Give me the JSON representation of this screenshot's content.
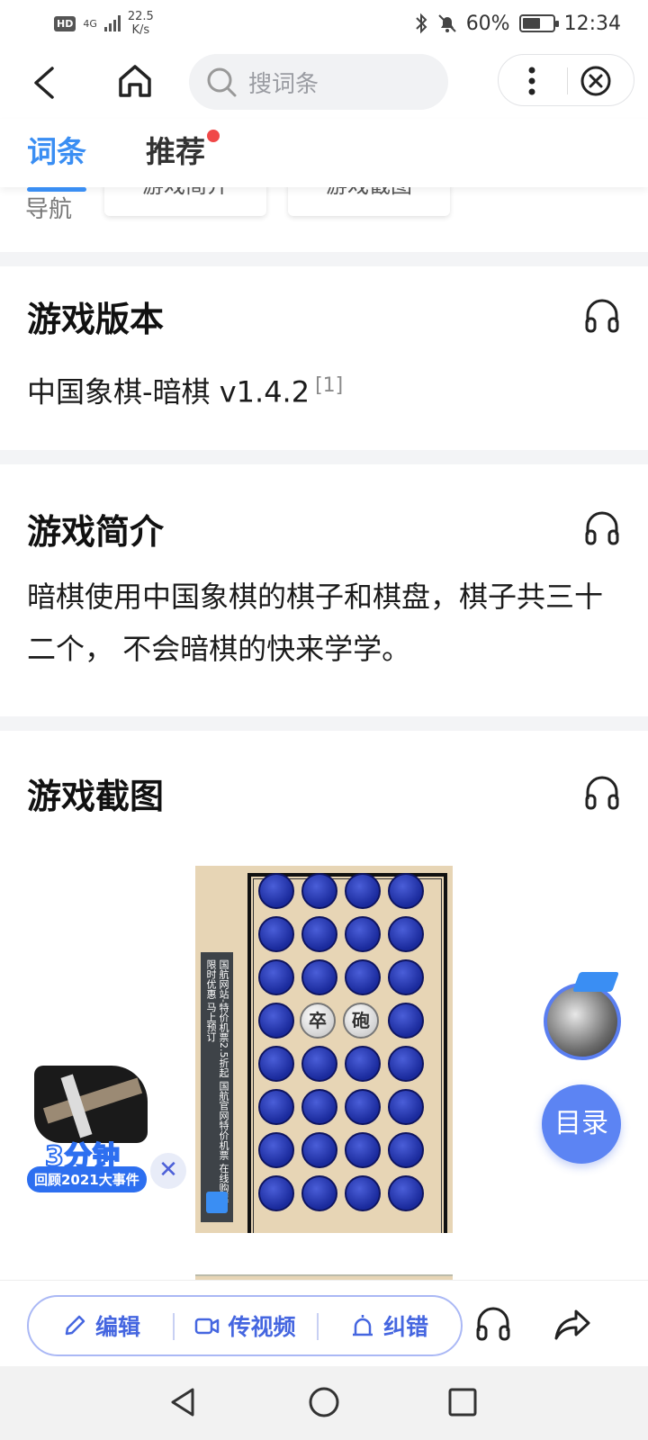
{
  "status_bar": {
    "hd": "HD",
    "network": "4G",
    "speed_value": "22.5",
    "speed_unit": "K/s",
    "battery": "60%",
    "battery_level": 0.6,
    "time": "12:34"
  },
  "header": {
    "search_placeholder": "搜词条"
  },
  "tabs": [
    {
      "label": "词条",
      "active": true
    },
    {
      "label": "推荐",
      "active": false,
      "badge_dot": true
    }
  ],
  "guide": {
    "label": "导航",
    "chips": [
      "游戏简介",
      "游戏截图"
    ]
  },
  "sections": {
    "version": {
      "title": "游戏版本",
      "text": "中国象棋-暗棋 v1.4.2",
      "ref": "[1]"
    },
    "intro": {
      "title": "游戏简介",
      "text": "暗棋使用中国象棋的棋子和棋盘，棋子共三十二个， 不会暗棋的快来学学。"
    },
    "screenshots": {
      "title": "游戏截图",
      "board_ad_text": "国航网站-特价机票2.5折起 国航官网特价机票 在线购票 限时优惠 马上预订",
      "pieces": [
        {
          "label": "卒"
        },
        {
          "label": "砲"
        }
      ]
    }
  },
  "promo": {
    "big": "3分钟",
    "small": "回顾2021大事件",
    "close": "✕"
  },
  "floating": {
    "toc_label": "目录"
  },
  "bottom_actions": [
    {
      "label": "编辑",
      "icon": "pencil-icon"
    },
    {
      "label": "传视频",
      "icon": "video-icon"
    },
    {
      "label": "纠错",
      "icon": "alarm-icon"
    }
  ],
  "colors": {
    "accent": "#3a8ef3",
    "action_blue": "#4566e0",
    "toc_blue": "#5c84f3",
    "badge_red": "#f04848"
  }
}
